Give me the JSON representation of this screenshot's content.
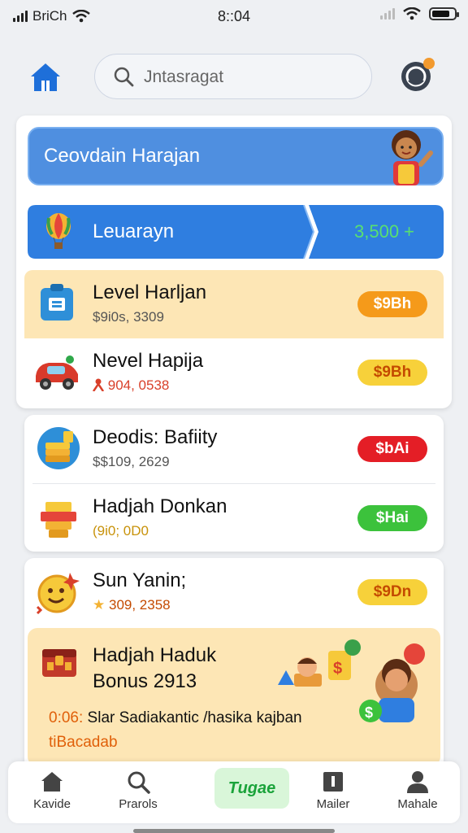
{
  "status_bar": {
    "carrier": "BriCh",
    "time": "8::04"
  },
  "search": {
    "placeholder": "Jntasragat"
  },
  "hero": {
    "title": "Ceovdain Harajan"
  },
  "ribbon": {
    "label": "Leuarayn",
    "value": "3,500 +"
  },
  "rows": [
    {
      "title": "Level Harljan",
      "subtitle": "$9i0s, 3309",
      "badge": "$9Bh",
      "badge_color": "#f59a1a",
      "badge_text_color": "#ffffff"
    },
    {
      "title": "Nevel Hapija",
      "subtitle": "904, 0538",
      "badge": "$9Bh",
      "badge_color": "#f7d13a",
      "badge_text_color": "#c44a00"
    },
    {
      "title": "Deodis: Bafiity",
      "subtitle": "$$109, 2629",
      "badge": "$bAi",
      "badge_color": "#e41e26",
      "badge_text_color": "#ffffff"
    },
    {
      "title": "Hadjah Donkan",
      "subtitle": "(9i0; 0D0",
      "badge": "$Hai",
      "badge_color": "#3cc23c",
      "badge_text_color": "#ffffff"
    },
    {
      "title": "Sun Yanin;",
      "subtitle": "309, 2358",
      "badge": "$9Dn",
      "badge_color": "#f7d13a",
      "badge_text_color": "#c44a00"
    }
  ],
  "promo": {
    "title_line1": "Hadjah Haduk",
    "title_line2": "Bonus 2913",
    "time": "0:06:",
    "text": " Slar Sadiakantic /hasika kajban",
    "text_line2": "tiBacadab"
  },
  "nav": [
    {
      "label": "Kavide"
    },
    {
      "label": "Prarols"
    },
    {
      "label": "Tugae"
    },
    {
      "label": "Mailer"
    },
    {
      "label": "Mahale"
    }
  ],
  "colors": {
    "accent": "#3d7fe0",
    "hero": "#4f8fe0",
    "promo_bg": "#fde6b5",
    "highlight_row": "#fde6b5",
    "nav_center": "#1aa33a"
  }
}
